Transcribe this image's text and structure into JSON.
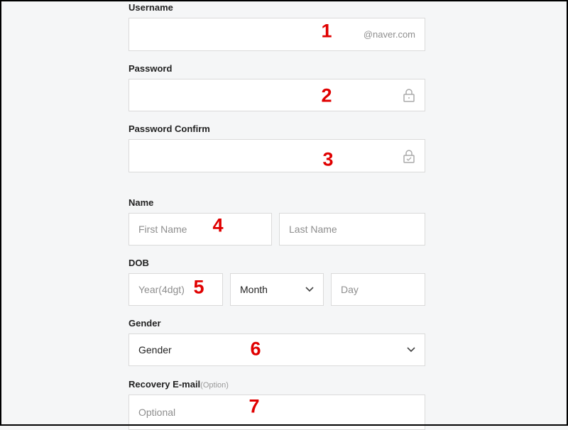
{
  "form": {
    "username": {
      "label": "Username",
      "suffix": "@naver.com"
    },
    "password": {
      "label": "Password",
      "icon": "lock-icon"
    },
    "password_confirm": {
      "label": "Password Confirm",
      "icon": "lock-check-icon"
    },
    "name": {
      "label": "Name",
      "first_placeholder": "First Name",
      "last_placeholder": "Last Name"
    },
    "dob": {
      "label": "DOB",
      "year_placeholder": "Year(4dgt)",
      "month_value": "Month",
      "day_placeholder": "Day"
    },
    "gender": {
      "label": "Gender",
      "value": "Gender"
    },
    "recovery": {
      "label": "Recovery E-mail",
      "label_note": "(Option)",
      "placeholder": "Optional"
    }
  },
  "annotations": [
    "1",
    "2",
    "3",
    "4",
    "5",
    "6",
    "7"
  ],
  "colors": {
    "annotation": "#e00000",
    "background": "#f5f6f7"
  }
}
